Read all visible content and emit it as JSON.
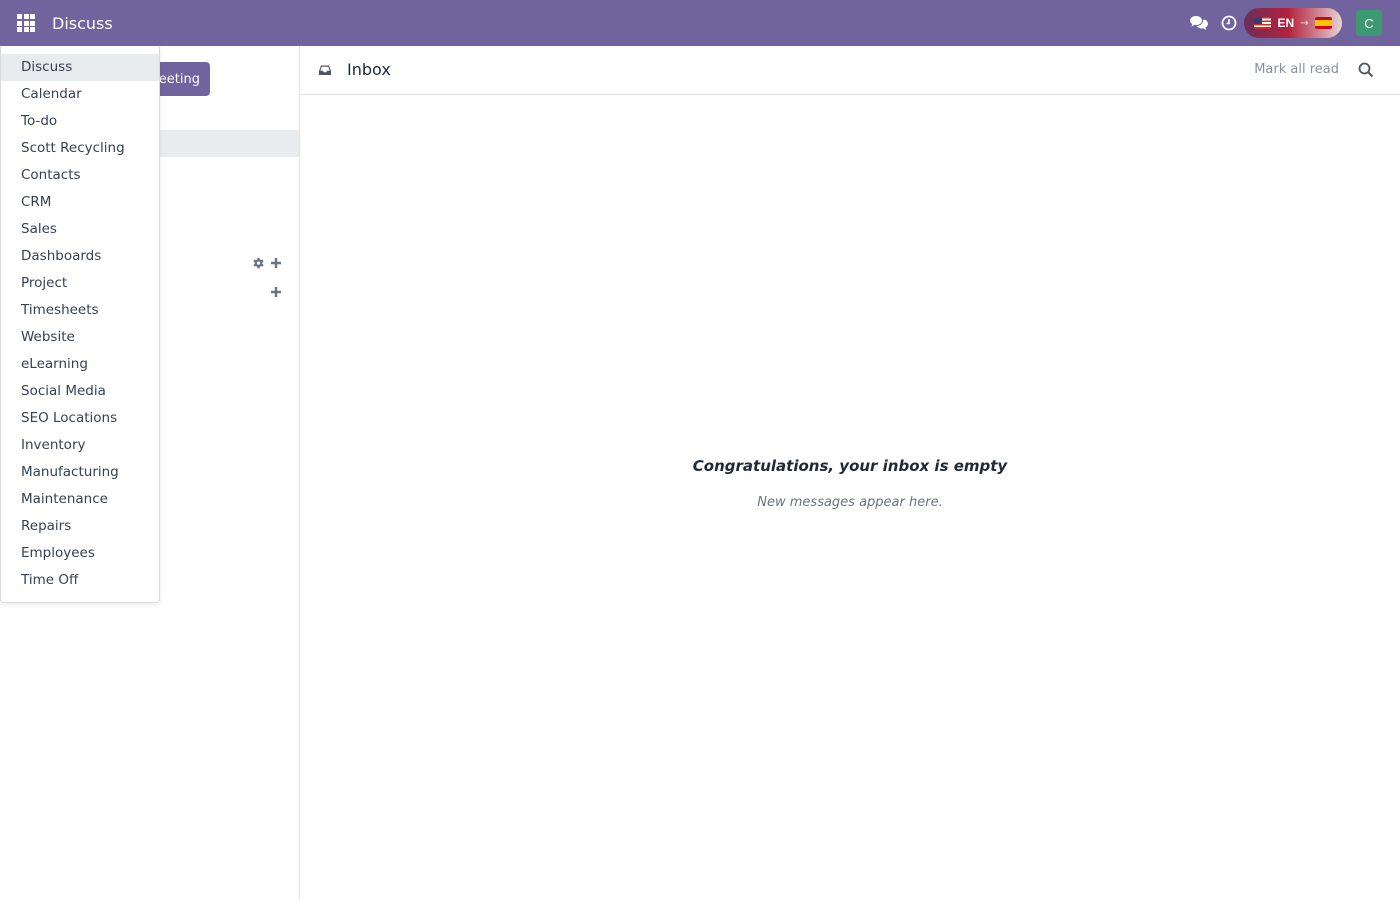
{
  "navbar": {
    "brand": "Discuss",
    "lang_from": "EN",
    "lang_arrow": "→",
    "avatar_initial": "C",
    "colors": {
      "bar": "#71639e",
      "avatar": "#3d9970"
    }
  },
  "sidebar": {
    "start_meeting_label": "Start a meeting",
    "visible_label_fragment": "eeting"
  },
  "main": {
    "title": "Inbox",
    "mark_all_read": "Mark all read",
    "empty_title": "Congratulations, your inbox is empty",
    "empty_subtitle": "New messages appear here."
  },
  "apps_menu": {
    "items": [
      {
        "label": "Discuss",
        "active": true
      },
      {
        "label": "Calendar"
      },
      {
        "label": "To-do"
      },
      {
        "label": "Scott Recycling"
      },
      {
        "label": "Contacts"
      },
      {
        "label": "CRM"
      },
      {
        "label": "Sales"
      },
      {
        "label": "Dashboards"
      },
      {
        "label": "Project"
      },
      {
        "label": "Timesheets"
      },
      {
        "label": "Website"
      },
      {
        "label": "eLearning"
      },
      {
        "label": "Social Media"
      },
      {
        "label": "SEO Locations"
      },
      {
        "label": "Inventory"
      },
      {
        "label": "Manufacturing"
      },
      {
        "label": "Maintenance"
      },
      {
        "label": "Repairs"
      },
      {
        "label": "Employees"
      },
      {
        "label": "Time Off"
      }
    ]
  },
  "icons": {
    "apps": "apps-grid-icon",
    "chat": "chat-bubbles-icon",
    "activity": "clock-icon",
    "settings": "gear-icon",
    "add": "plus-icon",
    "inbox": "inbox-icon",
    "search": "search-icon"
  }
}
